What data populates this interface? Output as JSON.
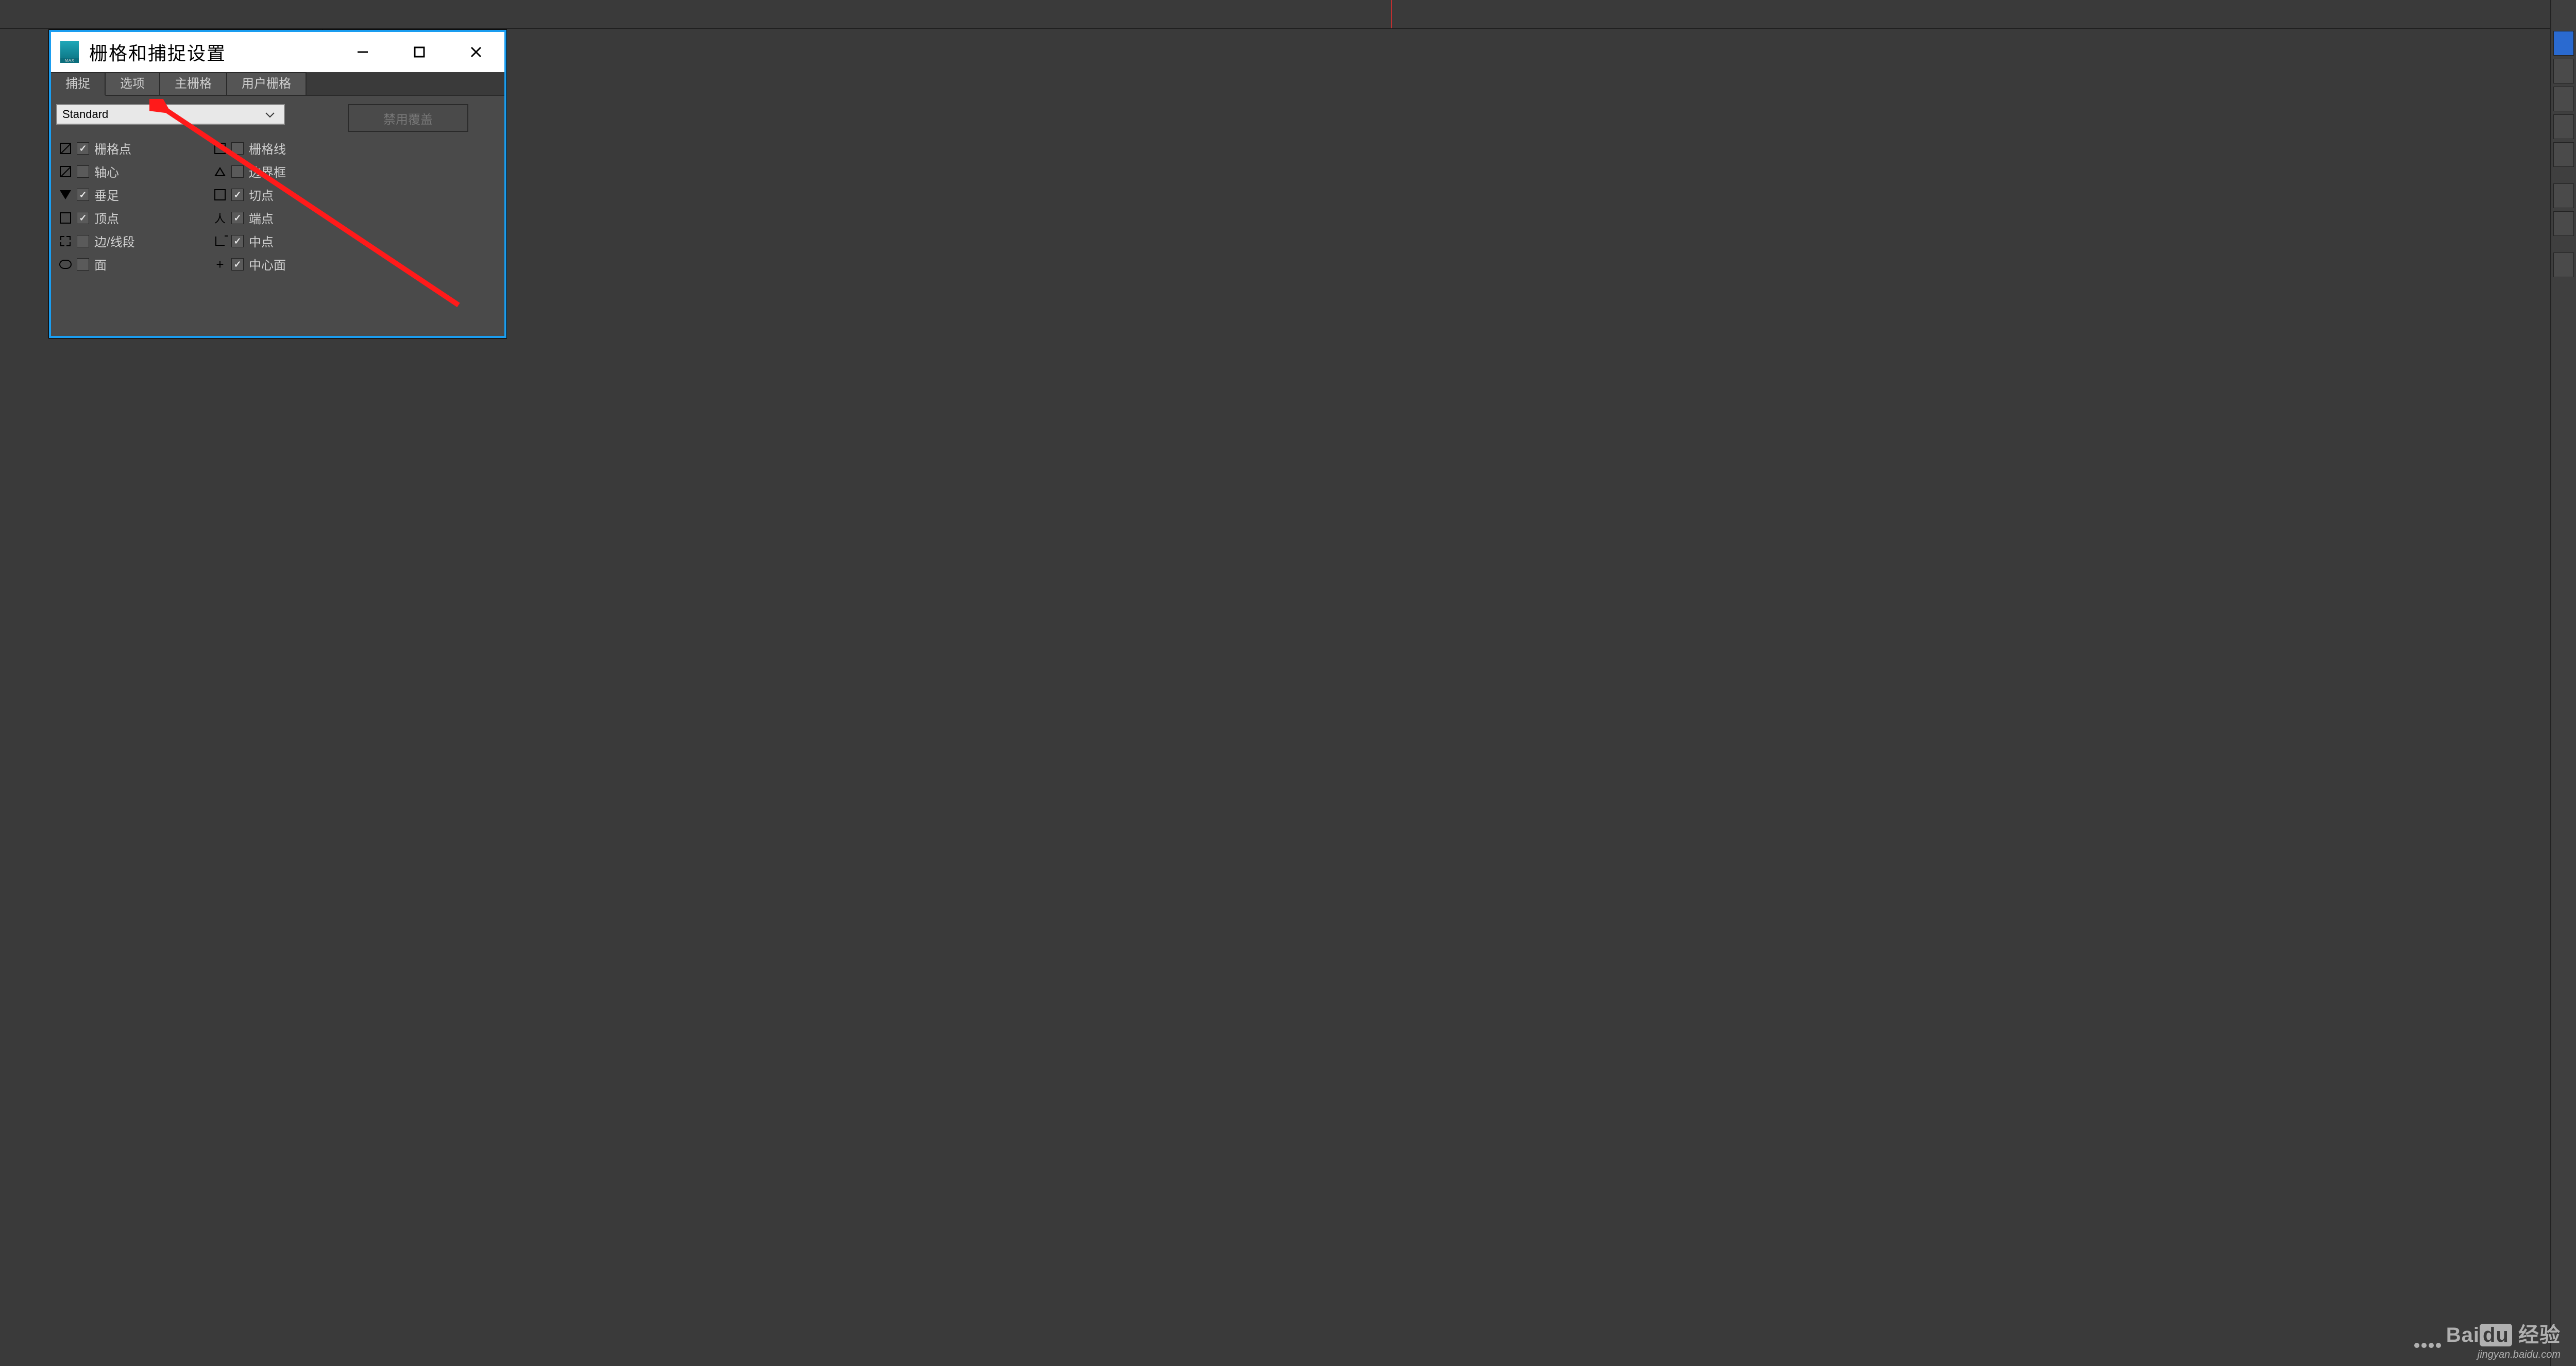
{
  "dialog": {
    "title": "栅格和捕捉设置",
    "tabs": [
      "捕捉",
      "选项",
      "主栅格",
      "用户栅格"
    ],
    "active_tab_index": 0,
    "combo_value": "Standard",
    "disable_override": "禁用覆盖",
    "snaps": {
      "left": [
        {
          "sym": "boxdiag",
          "checked": true,
          "label": "栅格点"
        },
        {
          "sym": "boxdiag",
          "checked": false,
          "label": "轴心"
        },
        {
          "sym": "tridn",
          "checked": true,
          "label": "垂足"
        },
        {
          "sym": "box",
          "checked": true,
          "label": "顶点"
        },
        {
          "sym": "corners",
          "checked": false,
          "label": "边/线段"
        },
        {
          "sym": "ell",
          "checked": false,
          "label": "面"
        }
      ],
      "right": [
        {
          "sym": "box",
          "checked": false,
          "label": "栅格线"
        },
        {
          "sym": "triup",
          "checked": false,
          "label": "边界框"
        },
        {
          "sym": "box",
          "checked": true,
          "label": "切点"
        },
        {
          "sym": "person",
          "checked": true,
          "label": "端点"
        },
        {
          "sym": "lshape",
          "checked": true,
          "label": "中点"
        },
        {
          "sym": "plus",
          "checked": true,
          "label": "中心面"
        }
      ]
    }
  },
  "watermark": {
    "brand": "Bai",
    "brand2": "du",
    "suffix": "经验",
    "url": "jingyan.baidu.com"
  }
}
